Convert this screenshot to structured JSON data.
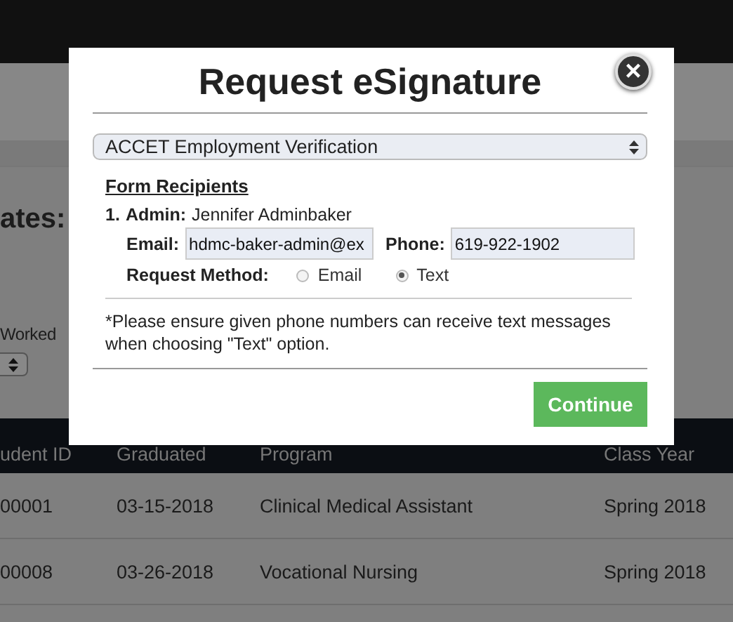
{
  "background": {
    "heading": "ates:",
    "filter_label": "Worked",
    "table": {
      "columns": [
        "udent ID",
        "Graduated",
        "Program",
        "Class Year"
      ],
      "rows": [
        [
          "00001",
          "03-15-2018",
          "Clinical Medical Assistant",
          "Spring 2018"
        ],
        [
          "00008",
          "03-26-2018",
          "Vocational Nursing",
          "Spring 2018"
        ]
      ]
    }
  },
  "modal": {
    "title": "Request eSignature",
    "close": "×",
    "form_select": "ACCET Employment Verification",
    "section_title": "Form Recipients",
    "recipients": [
      {
        "number": "1.",
        "role": "Admin:",
        "name": "Jennifer Adminbaker",
        "email_label": "Email:",
        "email": "hdmc-baker-admin@ex",
        "phone_label": "Phone:",
        "phone": "619-922-1902",
        "method_label": "Request Method:",
        "methods": [
          {
            "label": "Email",
            "selected": false
          },
          {
            "label": "Text",
            "selected": true
          }
        ]
      }
    ],
    "note": "*Please ensure given phone numbers can receive text messages when choosing \"Text\" option.",
    "continue": "Continue"
  }
}
